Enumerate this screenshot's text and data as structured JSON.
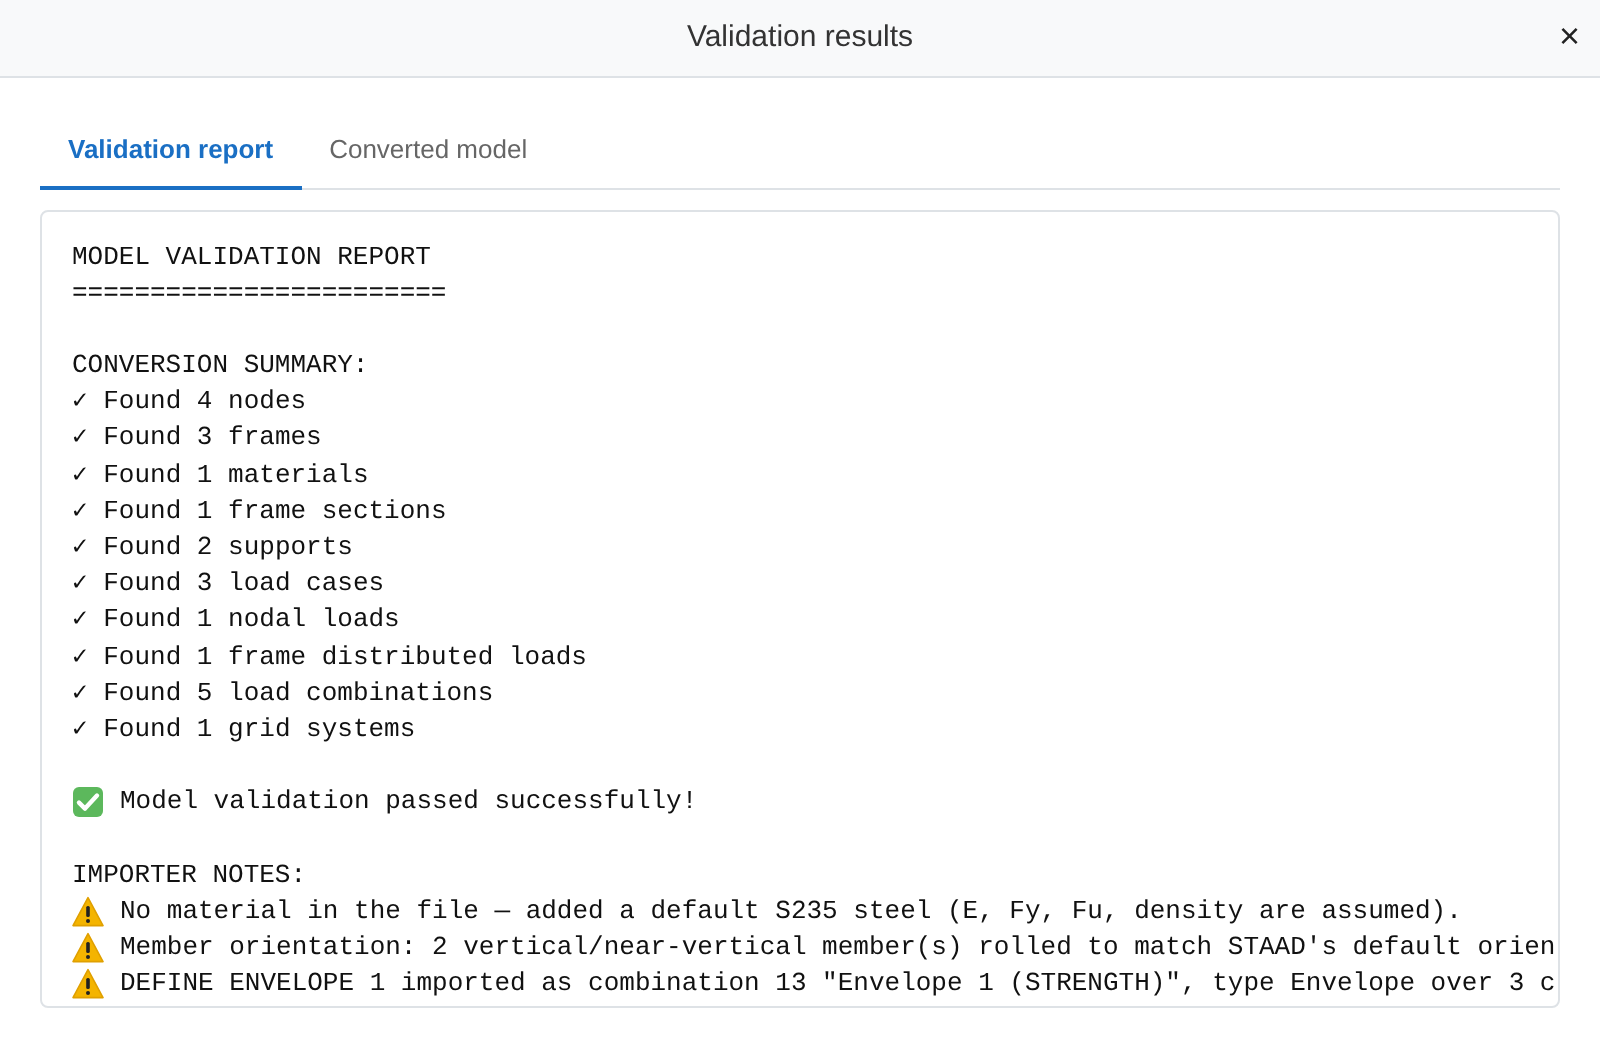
{
  "modal": {
    "title": "Validation results",
    "close": "×"
  },
  "tabs": [
    {
      "label": "Validation report",
      "selected": true
    },
    {
      "label": "Converted model",
      "selected": false
    }
  ],
  "report": {
    "sections": [
      {
        "lines": [
          {
            "kind": "text",
            "text": "MODEL VALIDATION REPORT"
          },
          {
            "kind": "text",
            "text": "========================"
          }
        ]
      },
      {
        "lines": [
          {
            "kind": "text",
            "text": "CONVERSION SUMMARY:"
          },
          {
            "kind": "text",
            "text": "✓ Found 4 nodes"
          },
          {
            "kind": "text",
            "text": "✓ Found 3 frames"
          },
          {
            "kind": "text",
            "text": "✓ Found 1 materials"
          },
          {
            "kind": "text",
            "text": "✓ Found 1 frame sections"
          },
          {
            "kind": "text",
            "text": "✓ Found 2 supports"
          },
          {
            "kind": "text",
            "text": "✓ Found 3 load cases"
          },
          {
            "kind": "text",
            "text": "✓ Found 1 nodal loads"
          },
          {
            "kind": "text",
            "text": "✓ Found 1 frame distributed loads"
          },
          {
            "kind": "text",
            "text": "✓ Found 5 load combinations"
          },
          {
            "kind": "text",
            "text": "✓ Found 1 grid systems"
          }
        ]
      },
      {
        "lines": [
          {
            "kind": "success",
            "text": "Model validation passed successfully!"
          }
        ]
      },
      {
        "lines": [
          {
            "kind": "text",
            "text": "IMPORTER NOTES:"
          },
          {
            "kind": "warning",
            "text": "No material in the file — added a default S235 steel (E, Fy, Fu, density are assumed)."
          },
          {
            "kind": "warning",
            "text": "Member orientation: 2 vertical/near-vertical member(s) rolled to match STAAD's default orien"
          },
          {
            "kind": "warning",
            "text": "DEFINE ENVELOPE 1 imported as combination 13 \"Envelope 1 (STRENGTH)\", type Envelope over 3 c"
          }
        ]
      }
    ]
  }
}
